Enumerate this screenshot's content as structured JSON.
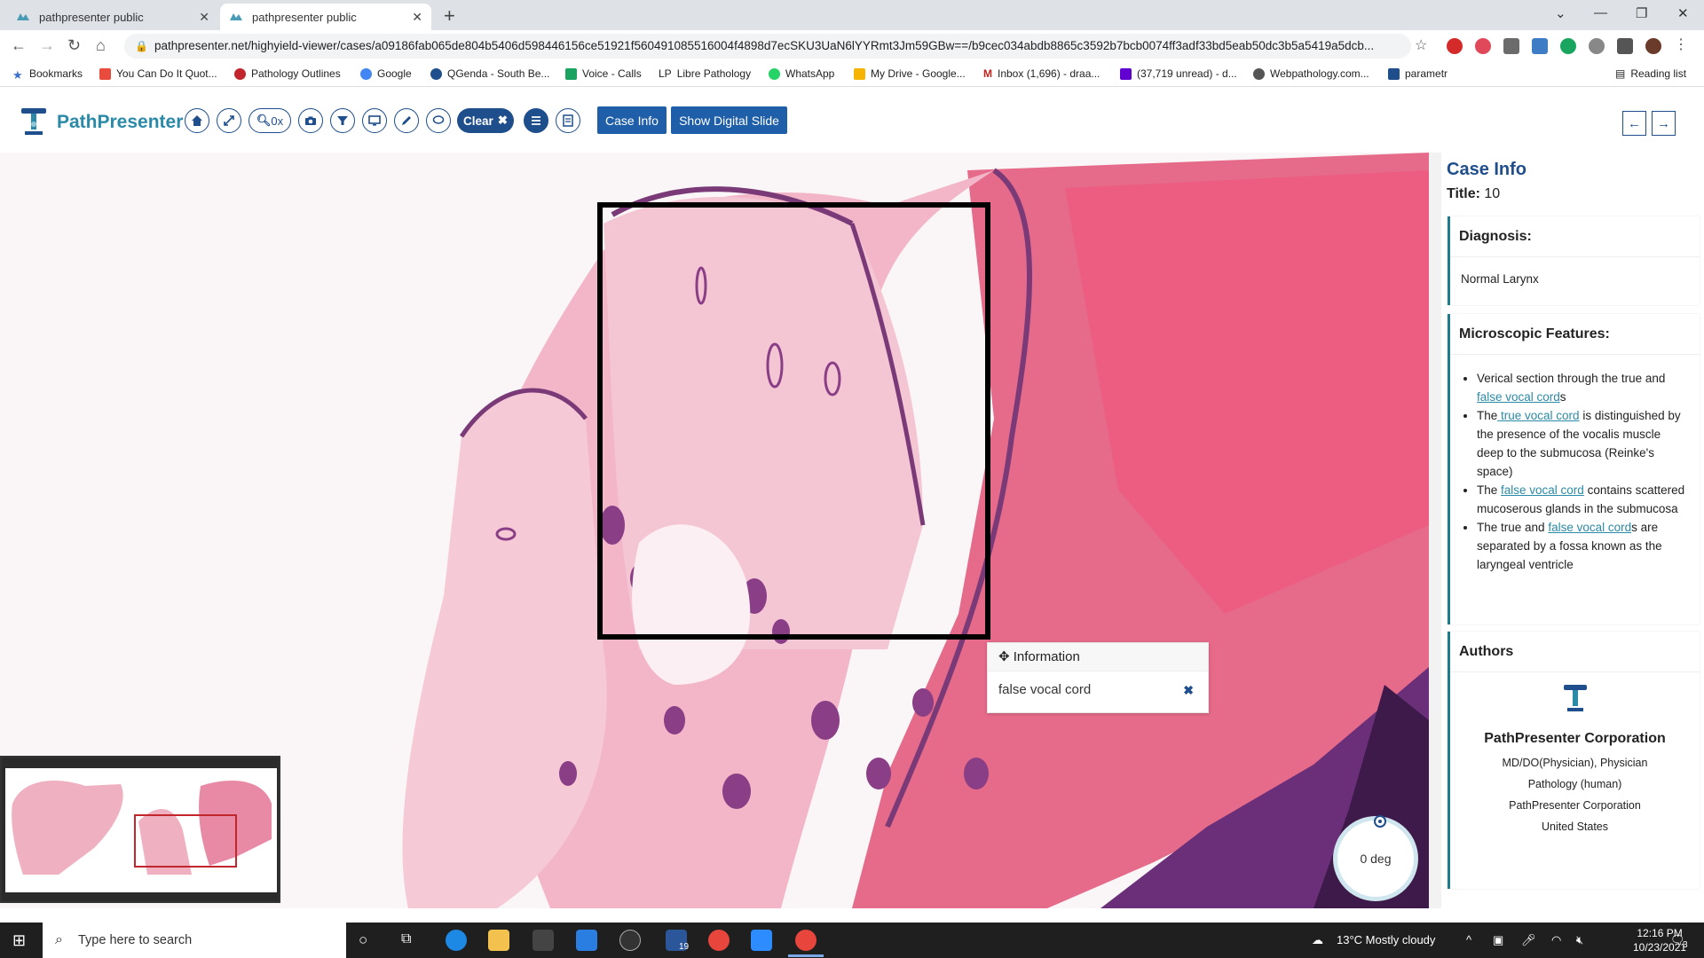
{
  "browser": {
    "tabs": [
      {
        "title": "pathpresenter public"
      },
      {
        "title": "pathpresenter public"
      }
    ],
    "url": "pathpresenter.net/highyield-viewer/cases/a09186fab065de804b5406d598446156ce51921f560491085516004f4898d7ecSKU3UaN6lYYRmt3Jm59GBw==/b9cec034abdb8865c3592b7bcb0074ff3adf33bd5eab50dc3b5a5419a5dcb...",
    "bookmarks": [
      "Bookmarks",
      "You Can Do It Quot...",
      "Pathology Outlines",
      "Google",
      "QGenda - South Be...",
      "Voice - Calls",
      "Libre Pathology",
      "WhatsApp",
      "My Drive - Google...",
      "Inbox (1,696) - draa...",
      "(37,719 unread) - d...",
      "Webpathology.com...",
      "parametr"
    ],
    "reading_list": "Reading list"
  },
  "app": {
    "brand": "PathPresenter",
    "zoom_label": "0x",
    "clear_label": "Clear",
    "case_info_label": "Case Info",
    "show_slide_label": "Show Digital Slide"
  },
  "viewer": {
    "popup_header": "Information",
    "popup_text": "false vocal cord",
    "rotation_label": "0 deg"
  },
  "panel": {
    "heading": "Case Info",
    "title_label": "Title:",
    "title_value": "10",
    "diagnosis_label": "Diagnosis:",
    "diagnosis_value": "Normal Larynx",
    "micro_label": "Microscopic Features:",
    "micro": {
      "b1_pre": "Verical section through the true and ",
      "b1_link": "false vocal cord",
      "b1_post": "s",
      "b2_pre": "The",
      "b2_link": " true vocal cord",
      "b2_post": " is distinguished by the presence of the vocalis muscle deep to the submucosa (Reinke's space)",
      "b3_pre": "The ",
      "b3_link": "false vocal cord",
      "b3_post": " contains scattered mucoserous glands in the submucosa",
      "b4_pre": "The true and ",
      "b4_link": "false vocal cord",
      "b4_post": "s are separated by a fossa known as the laryngeal ventricle"
    },
    "authors_label": "Authors",
    "author": {
      "name": "PathPresenter Corporation",
      "role": "MD/DO(Physician), Physician",
      "specialty": "Pathology (human)",
      "org": "PathPresenter Corporation",
      "country": "United States"
    }
  },
  "taskbar": {
    "search_placeholder": "Type here to search",
    "weather": "13°C  Mostly cloudy",
    "time": "12:16 PM",
    "date": "10/23/2021",
    "badge": "19",
    "notif_count": "3"
  }
}
